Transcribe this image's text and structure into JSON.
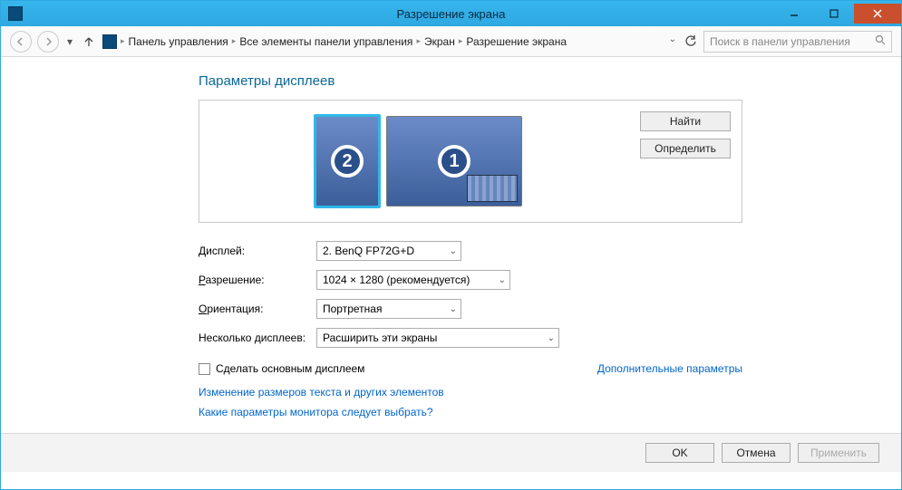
{
  "window": {
    "title": "Разрешение экрана"
  },
  "winbtns": {
    "min": "–",
    "max": "❐",
    "close": "✕"
  },
  "breadcrumb": {
    "items": [
      "Панель управления",
      "Все элементы панели управления",
      "Экран",
      "Разрешение экрана"
    ]
  },
  "search": {
    "placeholder": "Поиск в панели управления"
  },
  "heading": "Параметры дисплеев",
  "monitors": {
    "primary": "1",
    "secondary": "2"
  },
  "buttons": {
    "find": "Найти",
    "identify": "Определить"
  },
  "form": {
    "display_label": "Дисплей:",
    "display_value": "2. BenQ FP72G+D",
    "resolution_label": "Разрешение:",
    "resolution_value": "1024 × 1280 (рекомендуется)",
    "orientation_label": "Ориентация:",
    "orientation_value": "Портретная",
    "multi_label": "Несколько дисплеев:",
    "multi_value": "Расширить эти экраны"
  },
  "checkbox_label": "Сделать основным дисплеем",
  "adv_link": "Дополнительные параметры",
  "links": {
    "text_size": "Изменение размеров текста и других элементов",
    "which_monitor": "Какие параметры монитора следует выбрать?"
  },
  "footer": {
    "ok": "OK",
    "cancel": "Отмена",
    "apply": "Применить"
  }
}
